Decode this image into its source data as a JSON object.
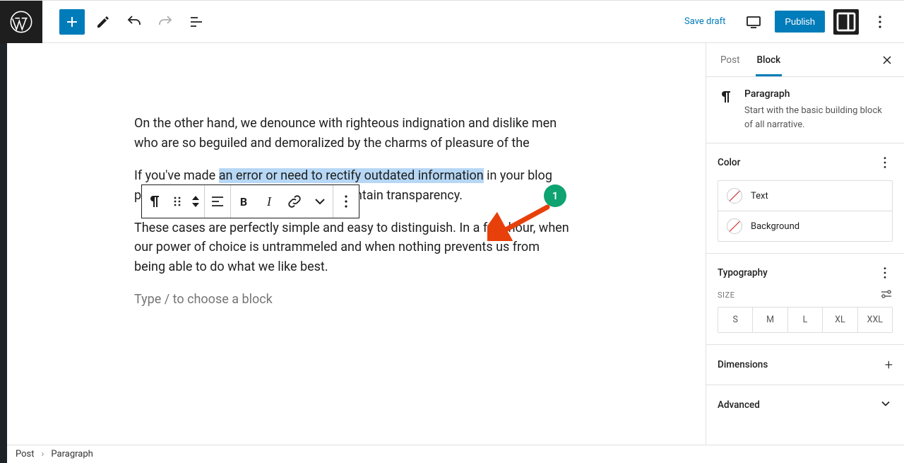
{
  "toolbar": {
    "save_draft": "Save draft",
    "publish": "Publish"
  },
  "editor": {
    "p1": "On the other hand, we denounce with righteous indignation and dislike men who are so beguiled and demoralized by the charms of pleasure of the",
    "p2_before": "If you've made ",
    "p2_highlight": "an error or need to rectify outdated information",
    "p2_after": " in your blog post, using strikethrough helps you maintain transparency.",
    "p3": "These cases are perfectly simple and easy to distinguish. In a free hour, when our power of choice is untrammeled and when nothing prevents us from being able to do what we like best.",
    "placeholder": "Type / to choose a block"
  },
  "block_toolbar": {
    "bold": "B",
    "italic": "I"
  },
  "annotation": {
    "badge": "1"
  },
  "sidebar": {
    "tab_post": "Post",
    "tab_block": "Block",
    "block_title": "Paragraph",
    "block_desc": "Start with the basic building block of all narrative.",
    "section_color": "Color",
    "color_text": "Text",
    "color_background": "Background",
    "section_typography": "Typography",
    "size_label": "SIZE",
    "sizes": [
      "S",
      "M",
      "L",
      "XL",
      "XXL"
    ],
    "section_dimensions": "Dimensions",
    "section_advanced": "Advanced"
  },
  "breadcrumb": {
    "root": "Post",
    "current": "Paragraph"
  }
}
